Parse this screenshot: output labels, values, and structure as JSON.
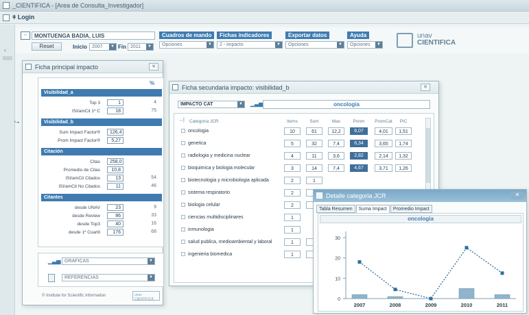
{
  "window": {
    "title": "_CIENTIFICA - [Area de Consulta_Investigador]"
  },
  "menu": {
    "login": "Login"
  },
  "header": {
    "user": "MONTUENGA BADIA, LUIS",
    "reset": "Reset",
    "inicio_label": "Inicio",
    "inicio_value": "2007",
    "fin_label": "Fin",
    "fin_value": "2011",
    "groups": [
      {
        "label": "Cuadros de mando",
        "value": "Opciones"
      },
      {
        "label": "Fichas indicadores",
        "value": "2 - impacto"
      },
      {
        "label": "Exportar datos",
        "value": "Opciones"
      },
      {
        "label": "Ayuda",
        "value": "Opciones"
      }
    ],
    "logo_line1": "unav",
    "logo_line2": "CIENTIFICA"
  },
  "ficha_principal": {
    "title": "Ficha principal impacto",
    "pct_header": "%",
    "sections": [
      {
        "name": "Visibilidad_a",
        "rows": [
          {
            "label": "Top 3",
            "value": "1",
            "pct": "4"
          },
          {
            "label": "ISI/amCit 1º C",
            "value": "18",
            "pct": "75"
          }
        ]
      },
      {
        "name": "Visibilidad_b",
        "rows": [
          {
            "label": "Sum Impact Factor®",
            "value": "126,4",
            "pct": ""
          },
          {
            "label": "Prom Impact Factor®",
            "value": "5,27",
            "pct": ""
          }
        ]
      },
      {
        "name": "Citación",
        "rows": [
          {
            "label": "Citas",
            "value": "258,0",
            "pct": ""
          },
          {
            "label": "Promedio de Citas",
            "value": "10,8",
            "pct": ""
          },
          {
            "label": "ISI/amCit Citados",
            "value": "13",
            "pct": "54"
          },
          {
            "label": "ISI/amCit No Citados",
            "value": "11",
            "pct": "46"
          }
        ]
      },
      {
        "name": "Citantes",
        "rows": [
          {
            "label": "desde UNAV",
            "value": "23",
            "pct": "9"
          },
          {
            "label": "desde Review",
            "value": "86",
            "pct": "33"
          },
          {
            "label": "desde Top3",
            "value": "40",
            "pct": "16"
          },
          {
            "label": "desde 1º Cuartil",
            "value": "176",
            "pct": "68"
          }
        ]
      }
    ],
    "graficas": "GRAFICAS",
    "referencias": "REFERENCIAS",
    "footer": "© Institute for Scientific Information",
    "footer_logo": "unav CIENTIFICA"
  },
  "ficha_secundaria": {
    "title": "Ficha secundaria impacto: visibilidad_b",
    "select": "IMPACTO CAT",
    "selected_name": "oncologia",
    "columns": [
      "Categoria JCR",
      "Items",
      "Sum",
      "Max",
      "Ponm",
      "PromCat",
      "PIC"
    ],
    "rows": [
      {
        "cat": "oncologia",
        "items": "10",
        "sum": "61",
        "max": "12,2",
        "ponm": "6,07",
        "promcat": "4,01",
        "pic": "1,51"
      },
      {
        "cat": "genetica",
        "items": "5",
        "sum": "32",
        "max": "7,4",
        "ponm": "6,34",
        "promcat": "3,65",
        "pic": "1,74"
      },
      {
        "cat": "radiologia y medicina nuclear",
        "items": "4",
        "sum": "11",
        "max": "3,6",
        "ponm": "2,82",
        "promcat": "2,14",
        "pic": "1,32"
      },
      {
        "cat": "bioquimica y biologia molecular",
        "items": "3",
        "sum": "14",
        "max": "7,4",
        "ponm": "4,67",
        "promcat": "3,71",
        "pic": "1,26"
      },
      {
        "cat": "biotecnologia y microbiologia aplicada",
        "items": "2",
        "sum": "1",
        "max": "",
        "ponm": "",
        "promcat": "",
        "pic": ""
      },
      {
        "cat": "sistema respiratorio",
        "items": "2",
        "sum": "1",
        "max": "",
        "ponm": "",
        "promcat": "",
        "pic": ""
      },
      {
        "cat": "biologia celular",
        "items": "2",
        "sum": "1",
        "max": "",
        "ponm": "",
        "promcat": "",
        "pic": ""
      },
      {
        "cat": "ciencias multidisciplinares",
        "items": "1",
        "sum": "",
        "max": "",
        "ponm": "",
        "promcat": "",
        "pic": ""
      },
      {
        "cat": "inmunologia",
        "items": "1",
        "sum": "",
        "max": "",
        "ponm": "",
        "promcat": "",
        "pic": ""
      },
      {
        "cat": "salud publica, medioambiental y laboral",
        "items": "1",
        "sum": "4",
        "max": "",
        "ponm": "",
        "promcat": "",
        "pic": ""
      },
      {
        "cat": "ingenieria biomedica",
        "items": "1",
        "sum": "3",
        "max": "",
        "ponm": "",
        "promcat": "",
        "pic": ""
      }
    ]
  },
  "detalle": {
    "title": "Detalle categoria JCR",
    "tabs": [
      "Tabla Resumen",
      "Suma Impact",
      "Promedio Impact"
    ],
    "active_tab": 1,
    "chart_title": "oncologia"
  },
  "chart_data": {
    "type": "line",
    "title": "oncologia",
    "categories": [
      "2007",
      "2008",
      "2009",
      "2010",
      "2011"
    ],
    "series": [
      {
        "values": [
          18,
          4.5,
          0,
          25,
          12.5
        ]
      },
      {
        "values": [
          2,
          1,
          0,
          5,
          2
        ]
      }
    ],
    "ylim": [
      0,
      33
    ],
    "yticks": [
      "0",
      "10",
      "20",
      "30"
    ]
  },
  "colors": {
    "accent": "#3f7bb0",
    "line": "#2d6f9e",
    "bar": "#8fb4cc"
  }
}
